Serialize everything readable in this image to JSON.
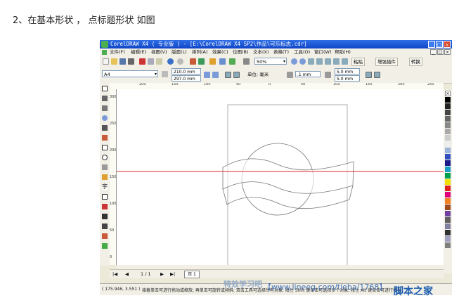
{
  "caption": "2、在基本形状 ， 点标题形状 如图",
  "window": {
    "title": "CorelDRAW X4 ( 专业版 ) - [E:\\CorelDRAW X4 SP2\\作品\\可乐标志.cdr]",
    "buttons": [
      "_",
      "□",
      "×"
    ]
  },
  "menu": [
    "文件(F)",
    "编辑(E)",
    "视图(V)",
    "版面(L)",
    "排列(A)",
    "效果(C)",
    "位图(B)",
    "文本(X)",
    "表格(T)",
    "工具(O)",
    "窗口(W)",
    "帮助(H)"
  ],
  "toolbar": {
    "zoom": "50%",
    "paste_label": "粘贴",
    "extensions_label": "增强插件",
    "transform_label": "转换"
  },
  "properties": {
    "paper": "A4",
    "width": "210.0 mm",
    "height": "297.0 mm",
    "units_label": "单位: 毫米",
    "nudge": ".1 mm",
    "dup_x": "5.0 mm",
    "dup_y": "5.0 mm"
  },
  "page_nav": {
    "first": "|◀",
    "prev": "◀",
    "page_count": "1 / 1",
    "next": "▶",
    "last": "▶|",
    "tab": "页 1"
  },
  "status": {
    "coords": "( 175.946, 3.551 )",
    "hint": "接着单击可进行拖动或缩放; 再单击可旋转或倾斜; 双击工具可选择所有对象; 按住 Shift 键单击可选择多个对象; 按住 Alt 键单击可进行挖掘"
  },
  "watermark": {
    "left": "特效学习吧",
    "url": "【www.lineeg.com/tieba/1768】",
    "brand": "脚本之家"
  },
  "colors": {
    "title_blue": "#1f58d8",
    "guideline": "#e3262b",
    "chrome": "#ece9d8"
  },
  "icons": {
    "pick_tool": "arrow-pointer-icon",
    "text_tool": "text-tool-icon",
    "zoom_tool": "magnifier-icon"
  },
  "ruler_h": [
    "200",
    "150",
    "100",
    "50",
    "0",
    "50",
    "100",
    "150",
    "200",
    "250"
  ],
  "ruler_v": [
    "300",
    "250",
    "200",
    "150",
    "100",
    "50",
    "0"
  ]
}
